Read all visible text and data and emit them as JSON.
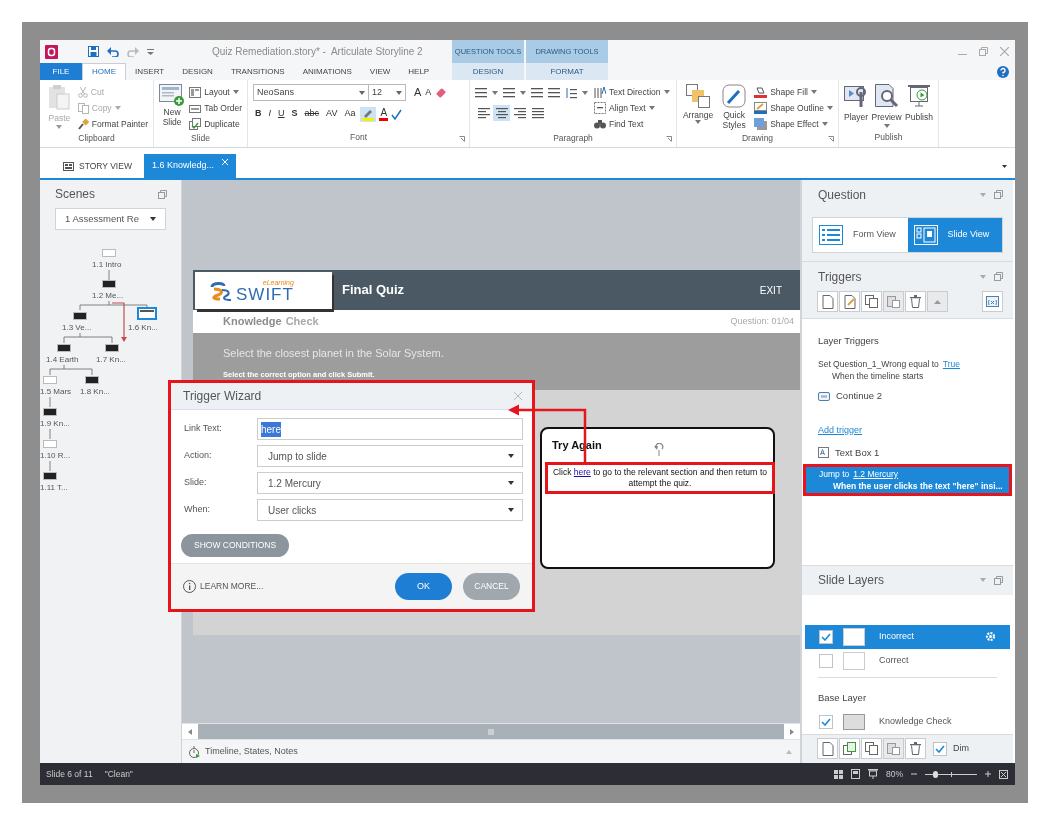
{
  "window": {
    "title": "Quiz Remediation.story* -  Articulate Storyline 2"
  },
  "context_tabs": [
    {
      "group": "QUESTION TOOLS",
      "tab": "DESIGN"
    },
    {
      "group": "DRAWING TOOLS",
      "tab": "FORMAT"
    }
  ],
  "ribbon_tabs": [
    {
      "label": "FILE",
      "kind": "file",
      "selected": false
    },
    {
      "label": "HOME",
      "kind": "tab",
      "selected": true
    },
    {
      "label": "INSERT",
      "kind": "tab",
      "selected": false
    },
    {
      "label": "DESIGN",
      "kind": "tab",
      "selected": false
    },
    {
      "label": "TRANSITIONS",
      "kind": "tab",
      "selected": false
    },
    {
      "label": "ANIMATIONS",
      "kind": "tab",
      "selected": false
    },
    {
      "label": "VIEW",
      "kind": "tab",
      "selected": false
    },
    {
      "label": "HELP",
      "kind": "tab",
      "selected": false
    }
  ],
  "ribbon": {
    "clipboard": {
      "title": "Clipboard",
      "paste": {
        "label": "Paste",
        "disabled": true
      },
      "items": [
        {
          "label": "Cut",
          "disabled": true
        },
        {
          "label": "Copy",
          "disabled": true
        },
        {
          "label": "Format Painter",
          "disabled": false
        }
      ]
    },
    "slide": {
      "title": "Slide",
      "new_slide": "New Slide",
      "items": [
        "Layout",
        "Tab Order",
        "Duplicate"
      ]
    },
    "font": {
      "title": "Font",
      "font_name": "NeoSans",
      "font_size": "12",
      "size_buttons": [
        "A",
        "A"
      ],
      "styles": [
        "B",
        "I",
        "U",
        "S",
        "abc",
        "AV",
        "Aa"
      ],
      "font_color": "A"
    },
    "paragraph": {
      "title": "Paragraph",
      "alignments": [
        {
          "selected": false
        },
        {
          "selected": true
        },
        {
          "selected": false
        },
        {
          "selected": false
        }
      ],
      "items": [
        "Text Direction",
        "Align Text",
        "Find Text"
      ]
    },
    "drawing": {
      "title": "Drawing",
      "large": [
        "Arrange",
        "Quick Styles"
      ],
      "items": [
        "Shape Fill",
        "Shape Outline",
        "Shape Effect"
      ]
    },
    "publish": {
      "title": "Publish",
      "items": [
        "Player",
        "Preview",
        "Publish"
      ]
    }
  },
  "doc_tabs": [
    {
      "label": "STORY VIEW",
      "selected": false
    },
    {
      "label": "1.6 Knowledg...",
      "selected": true
    }
  ],
  "scenes": {
    "title": "Scenes",
    "scene": "1 Assessment Re",
    "slides": [
      {
        "label": "1.1 Intro",
        "selected": false
      },
      {
        "label": "1.2 Me...",
        "selected": false
      },
      {
        "label": "1.3 Ve...",
        "selected": false
      },
      {
        "label": "1.6 Kn...",
        "selected": true
      },
      {
        "label": "1.4 Earth",
        "selected": false
      },
      {
        "label": "1.7 Kn...",
        "selected": false
      },
      {
        "label": "1.5 Mars",
        "selected": false
      },
      {
        "label": "1.8 Kn...",
        "selected": false
      },
      {
        "label": "1.9 Kn...",
        "selected": false
      },
      {
        "label": "1.10 R...",
        "selected": false
      },
      {
        "label": "1.11 T...",
        "selected": false
      }
    ]
  },
  "slide": {
    "logo": {
      "name": "SWIFT",
      "tagline": "eLearning"
    },
    "title": "Final Quiz",
    "exit": "EXIT",
    "heading_parts": [
      "Knowledge",
      "Check"
    ],
    "progress": "Question: 01/04",
    "question": "Select the closest planet in the Solar System.",
    "instruction": "Select the correct option and click Submit.",
    "feedback": {
      "title": "Try Again",
      "text_before": "Click",
      "link": "here",
      "text_after": "to go to the relevant section and then return to attempt the quiz."
    }
  },
  "trigger_wizard": {
    "title": "Trigger Wizard",
    "fields": [
      {
        "label": "Link Text:",
        "kind": "text",
        "value": "here",
        "highlighted": true
      },
      {
        "label": "Action:",
        "kind": "dropdown",
        "value": "Jump to slide"
      },
      {
        "label": "Slide:",
        "kind": "dropdown",
        "value": "1.2 Mercury"
      },
      {
        "label": "When:",
        "kind": "dropdown",
        "value": "User clicks"
      }
    ],
    "show_conditions": "SHOW CONDITIONS",
    "learn_more": "LEARN MORE...",
    "ok": "OK",
    "cancel": "CANCEL"
  },
  "timeline_bar": {
    "label": "Timeline, States, Notes"
  },
  "question_panel": {
    "title": "Question",
    "views": [
      {
        "label": "Form View",
        "selected": false
      },
      {
        "label": "Slide View",
        "selected": true
      }
    ]
  },
  "triggers": {
    "title": "Triggers",
    "items": [
      {
        "kind": "heading",
        "text": "Layer Triggers"
      },
      {
        "kind": "trigger",
        "action": "Set Question_1_Wrong equal to",
        "link": "True",
        "condition": "When the timeline starts",
        "selected": false
      },
      {
        "kind": "button",
        "text": "Continue 2",
        "selected": false
      },
      {
        "kind": "add",
        "text": "Add trigger"
      },
      {
        "kind": "textbox",
        "text": "Text Box 1",
        "selected": false
      },
      {
        "kind": "trigger",
        "action": "Jump to",
        "link": "1.2 Mercury",
        "condition": "When the user clicks the text \"here\" insi...",
        "selected": true
      }
    ]
  },
  "layers": {
    "title": "Slide Layers",
    "items": [
      {
        "name": "Incorrect",
        "visible": true,
        "selected": true
      },
      {
        "name": "Correct",
        "visible": false,
        "selected": false
      }
    ],
    "base_title": "Base Layer",
    "base": {
      "name": "Knowledge Check",
      "visible": true
    },
    "dim": {
      "label": "Dim",
      "checked": true
    }
  },
  "status_bar": {
    "slide": "Slide 6 of 11",
    "theme": "\"Clean\"",
    "zoom": {
      "reading": "80%",
      "level": 0.2
    }
  }
}
